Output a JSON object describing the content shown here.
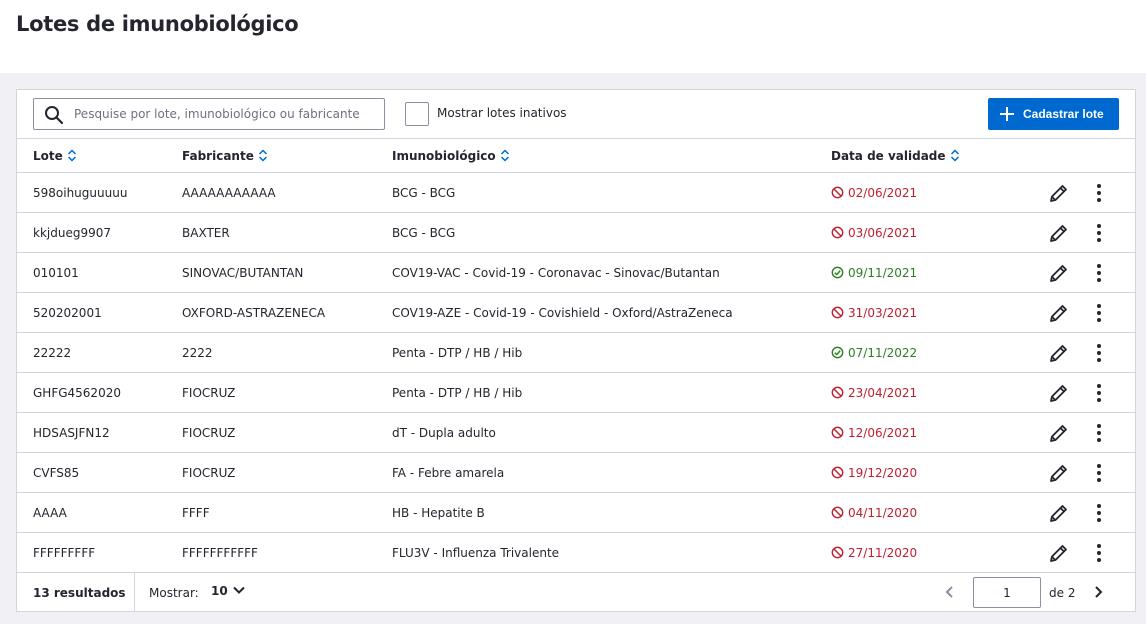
{
  "page": {
    "title": "Lotes de imunobiológico"
  },
  "toolbar": {
    "search_placeholder": "Pesquise por lote, imunobiológico ou fabricante",
    "show_inactive_label": "Mostrar lotes inativos",
    "add_button_label": "Cadastrar lote"
  },
  "table": {
    "headers": {
      "lote": "Lote",
      "fabricante": "Fabricante",
      "imuno": "Imunobiológico",
      "validade": "Data de validade"
    },
    "rows": [
      {
        "lote": "598oihuguuuuu",
        "fabricante": "AAAAAAAAAAA",
        "imuno": "BCG - BCG",
        "validade": "02/06/2021",
        "status": "expired"
      },
      {
        "lote": "kkjdueg9907",
        "fabricante": "BAXTER",
        "imuno": "BCG - BCG",
        "validade": "03/06/2021",
        "status": "expired"
      },
      {
        "lote": "010101",
        "fabricante": "SINOVAC/BUTANTAN",
        "imuno": "COV19-VAC - Covid-19 - Coronavac - Sinovac/Butantan",
        "validade": "09/11/2021",
        "status": "valid"
      },
      {
        "lote": "520202001",
        "fabricante": "OXFORD-ASTRAZENECA",
        "imuno": "COV19-AZE - Covid-19 - Covishield - Oxford/AstraZeneca",
        "validade": "31/03/2021",
        "status": "expired"
      },
      {
        "lote": "22222",
        "fabricante": "2222",
        "imuno": "Penta - DTP / HB / Hib",
        "validade": "07/11/2022",
        "status": "valid"
      },
      {
        "lote": "GHFG4562020",
        "fabricante": "FIOCRUZ",
        "imuno": "Penta - DTP / HB / Hib",
        "validade": "23/04/2021",
        "status": "expired"
      },
      {
        "lote": "HDSASJFN12",
        "fabricante": "FIOCRUZ",
        "imuno": "dT - Dupla adulto",
        "validade": "12/06/2021",
        "status": "expired"
      },
      {
        "lote": "CVFS85",
        "fabricante": "FIOCRUZ",
        "imuno": "FA - Febre amarela",
        "validade": "19/12/2020",
        "status": "expired"
      },
      {
        "lote": "AAAA",
        "fabricante": "FFFF",
        "imuno": "HB - Hepatite B",
        "validade": "04/11/2020",
        "status": "expired"
      },
      {
        "lote": "FFFFFFFFF",
        "fabricante": "FFFFFFFFFFF",
        "imuno": "FLU3V - Influenza Trivalente",
        "validade": "27/11/2020",
        "status": "expired"
      }
    ]
  },
  "footer": {
    "results": "13 resultados",
    "show_label": "Mostrar:",
    "page_size": "10",
    "current_page": "1",
    "of_pages": "de 2"
  },
  "colors": {
    "primary": "#0069d0",
    "expired": "#bf1e2e",
    "valid": "#2e7d24",
    "border": "#d3d4dd"
  },
  "icons": {
    "search": "search-icon",
    "add": "plus-icon",
    "sort": "sort-icon",
    "expired": "ban-icon",
    "valid": "check-circle-icon",
    "edit": "pencil-icon",
    "more": "more-vertical-icon"
  }
}
